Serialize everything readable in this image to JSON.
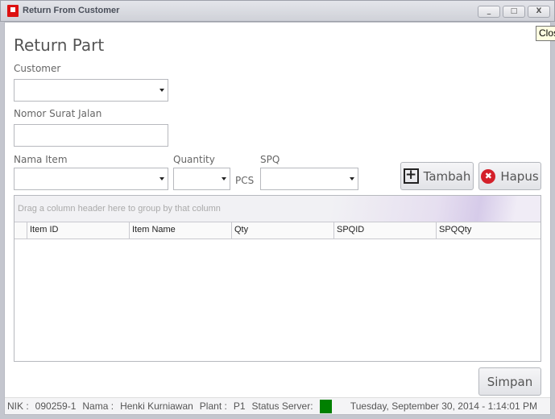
{
  "window": {
    "title": "Return From Customer",
    "tooltip": "Close",
    "minimize": "_",
    "maximize": "□",
    "close": "X"
  },
  "form": {
    "title": "Return Part",
    "customer_label": "Customer",
    "customer_value": "",
    "surat_label": "Nomor Surat Jalan",
    "surat_value": "",
    "item_label": "Nama Item",
    "qty_label": "Quantity",
    "unit": "PCS",
    "spq_label": "SPQ"
  },
  "buttons": {
    "tambah": "Tambah",
    "hapus": "Hapus",
    "simpan": "Simpan"
  },
  "grid": {
    "group_hint": "Drag a column header here to group by that column",
    "columns": [
      "Item ID",
      "Item Name",
      "Qty",
      "SPQID",
      "SPQQty"
    ],
    "rows": []
  },
  "status": {
    "nik_label": "NIK :",
    "nik": "090259-1",
    "nama_label": "Nama :",
    "nama": "Henki Kurniawan",
    "plant_label": "Plant :",
    "plant": "P1",
    "server_label": "Status Server:",
    "server_color": "#008000",
    "datetime": "Tuesday, September 30, 2014 - 1:14:01 PM"
  }
}
